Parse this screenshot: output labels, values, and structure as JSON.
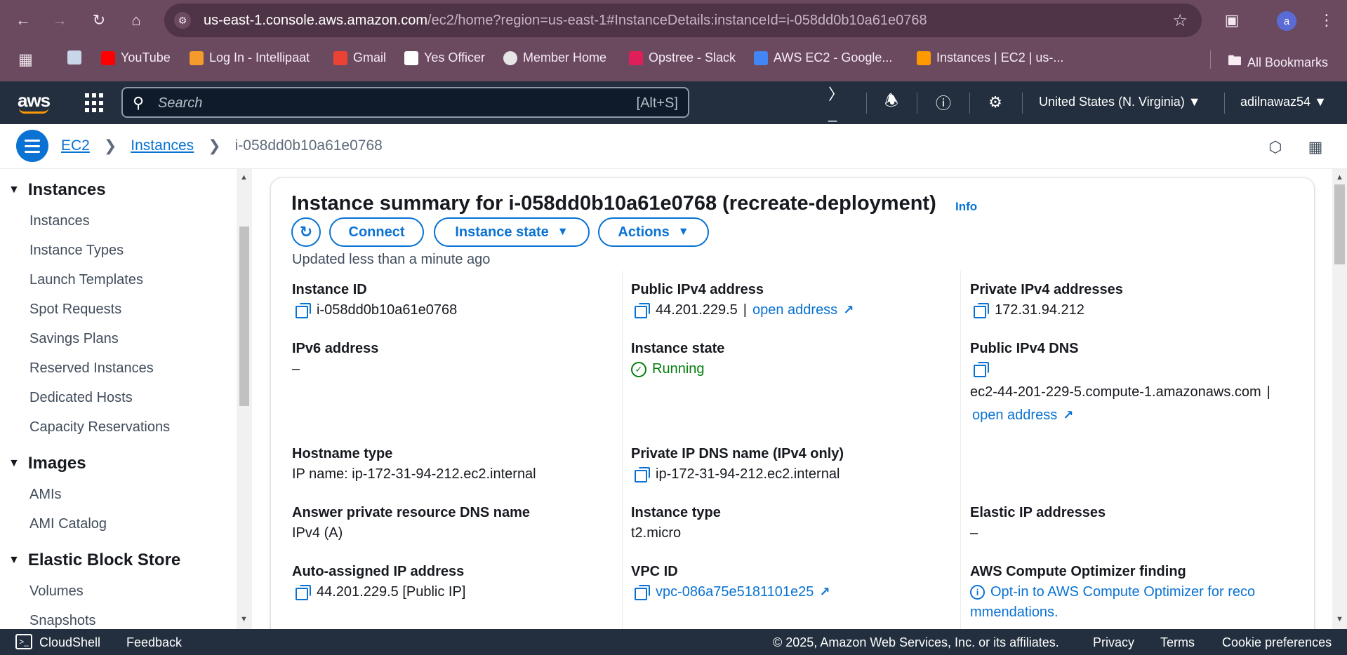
{
  "browser": {
    "url_host": "us-east-1.console.aws.amazon.com",
    "url_path": "/ec2/home?region=us-east-1#InstanceDetails:instanceId=i-058dd0b10a61e0768",
    "avatar_letter": "a",
    "bookmarks": [
      "YouTube",
      "Log In - Intellipaat",
      "Gmail",
      "Yes Officer",
      "Member Home",
      "Opstree - Slack",
      "AWS EC2 - Google...",
      "Instances | EC2 | us-..."
    ],
    "all_bookmarks": "All Bookmarks"
  },
  "aws": {
    "logo": "aws",
    "search_placeholder": "Search",
    "search_hint": "[Alt+S]",
    "region": "United States (N. Virginia) ▼",
    "user": "adilnawaz54 ▼"
  },
  "breadcrumb": {
    "ec2": "EC2",
    "instances": "Instances",
    "current": "i-058dd0b10a61e0768"
  },
  "sidebar": {
    "sections": [
      {
        "title": "Instances",
        "items": [
          "Instances",
          "Instance Types",
          "Launch Templates",
          "Spot Requests",
          "Savings Plans",
          "Reserved Instances",
          "Dedicated Hosts",
          "Capacity Reservations"
        ]
      },
      {
        "title": "Images",
        "items": [
          "AMIs",
          "AMI Catalog"
        ]
      },
      {
        "title": "Elastic Block Store",
        "items": [
          "Volumes",
          "Snapshots"
        ]
      }
    ]
  },
  "summary": {
    "title": "Instance summary for i-058dd0b10a61e0768 (recreate-deployment)",
    "info": "Info",
    "connect": "Connect",
    "instance_state": "Instance state",
    "actions": "Actions",
    "updated": "Updated less than a minute ago",
    "fields": {
      "instance_id_label": "Instance ID",
      "instance_id": "i-058dd0b10a61e0768",
      "public_ipv4_label": "Public IPv4 address",
      "public_ipv4": "44.201.229.5",
      "open_address": "open address",
      "private_ipv4_label": "Private IPv4 addresses",
      "private_ipv4": "172.31.94.212",
      "ipv6_label": "IPv6 address",
      "ipv6": "–",
      "state_label": "Instance state",
      "state": "Running",
      "public_dns_label": "Public IPv4 DNS",
      "public_dns": "ec2-44-201-229-5.compute-1.amazonaws.com",
      "hostname_type_label": "Hostname type",
      "hostname_type": "IP name: ip-172-31-94-212.ec2.internal",
      "private_dns_label": "Private IP DNS name (IPv4 only)",
      "private_dns": "ip-172-31-94-212.ec2.internal",
      "answer_dns_label": "Answer private resource DNS name",
      "answer_dns": "IPv4 (A)",
      "instance_type_label": "Instance type",
      "instance_type": "t2.micro",
      "elastic_ip_label": "Elastic IP addresses",
      "elastic_ip": "–",
      "auto_ip_label": "Auto-assigned IP address",
      "auto_ip": "44.201.229.5 [Public IP]",
      "vpc_label": "VPC ID",
      "vpc": "vpc-086a75e5181101e25",
      "optimizer_label": "AWS Compute Optimizer finding",
      "optimizer_line1": "Opt-in to AWS Compute Optimizer for reco",
      "optimizer_line2": "mmendations."
    }
  },
  "footer": {
    "cloudshell": "CloudShell",
    "feedback": "Feedback",
    "copyright": "© 2025, Amazon Web Services, Inc. or its affiliates.",
    "privacy": "Privacy",
    "terms": "Terms",
    "cookies": "Cookie preferences"
  },
  "colors": {
    "accent": "#0972d3",
    "nav": "#232f3e",
    "success": "#037f0c",
    "chrome": "#6b4a60"
  }
}
